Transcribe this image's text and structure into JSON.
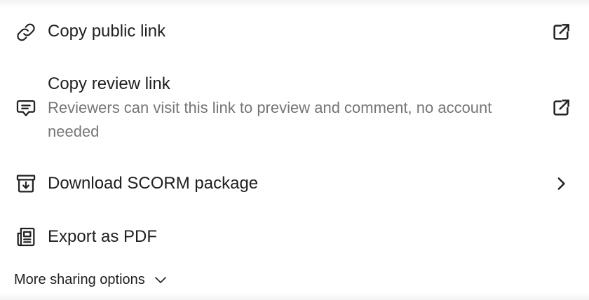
{
  "options": {
    "public_link": {
      "label": "Copy public link",
      "icon": "link-icon",
      "trailing_icon": "external-link-icon"
    },
    "review_link": {
      "label": "Copy review link",
      "description": "Reviewers can visit this link to preview and comment, no account needed",
      "icon": "comment-icon",
      "trailing_icon": "external-link-icon"
    },
    "scorm": {
      "label": "Download SCORM package",
      "icon": "archive-download-icon",
      "trailing_icon": "chevron-right-icon"
    },
    "pdf": {
      "label": "Export as PDF",
      "icon": "document-icon"
    }
  },
  "more_options": {
    "label": "More sharing options",
    "icon": "chevron-down-icon"
  },
  "colors": {
    "text": "#1f1f1f",
    "muted_text": "#767676"
  }
}
